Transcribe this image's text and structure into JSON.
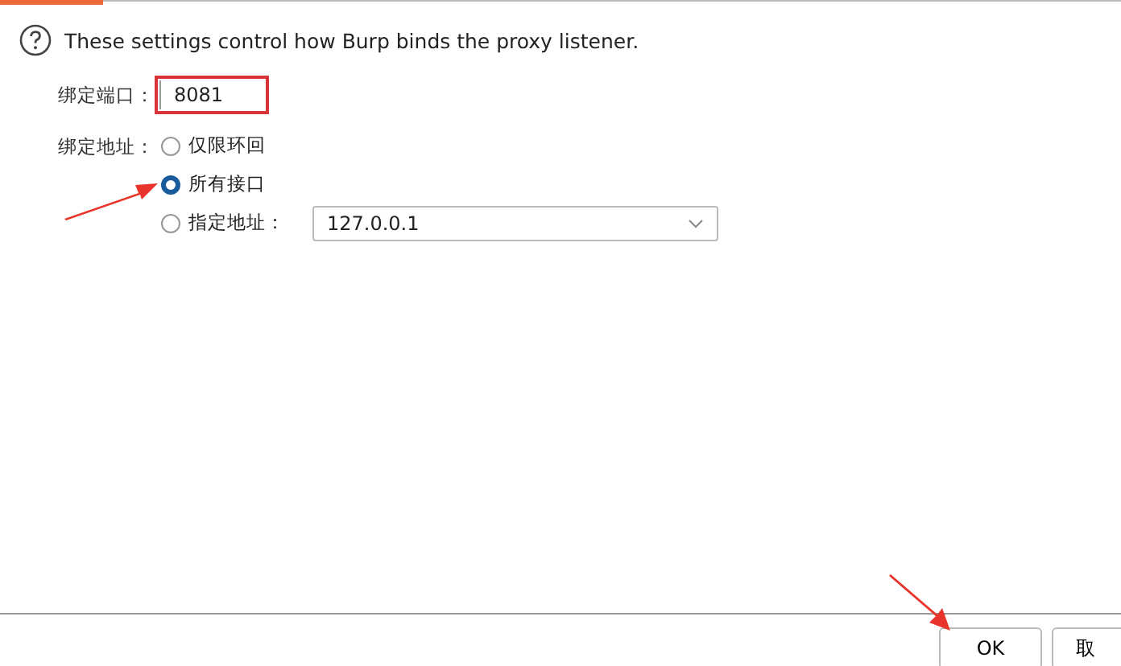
{
  "help_text": "These settings control how Burp binds the proxy listener.",
  "port": {
    "label": "绑定端口：",
    "value": "8081"
  },
  "address": {
    "label": "绑定地址：",
    "options": [
      {
        "label": "仅限环回",
        "selected": false,
        "kind": "plain"
      },
      {
        "label": "所有接口",
        "selected": true,
        "kind": "plain"
      },
      {
        "label": "指定地址：",
        "selected": false,
        "kind": "specific",
        "value": "127.0.0.1"
      }
    ]
  },
  "buttons": [
    {
      "label": "OK"
    },
    {
      "label": "取"
    }
  ]
}
